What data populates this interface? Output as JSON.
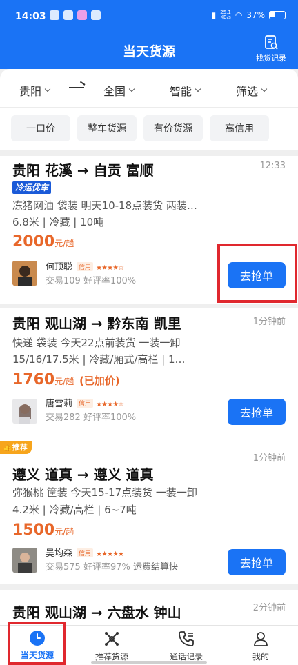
{
  "status_bar": {
    "time": "14:03",
    "speed_value": "25.1",
    "speed_unit": "KB/s",
    "battery": "37%"
  },
  "header": {
    "title": "当天货源",
    "find_record_label": "找货记录"
  },
  "filters": {
    "origin": "贵阳",
    "destination": "全国",
    "sort": "智能",
    "filter": "筛选"
  },
  "tags": [
    "一口价",
    "整车货源",
    "有价货源",
    "高信用"
  ],
  "cards": [
    {
      "route": "贵阳 花溪 → 自贡 富顺",
      "time": "12:33",
      "badge": "冷运优车",
      "desc1": "冻猪网油 袋装 明天10-18点装货 两装…",
      "desc2": "6.8米 | 冷藏 | 10吨",
      "price": "2000",
      "price_unit": "元/趟",
      "name": "何顶聪",
      "credit_label": "信用",
      "trade": "交易109 好评率100%",
      "button": "去抢单"
    },
    {
      "route": "贵阳 观山湖 → 黔东南 凯里",
      "time": "1分钟前",
      "desc1": "快递 袋装 今天22点前装货 一装一卸",
      "desc2": "15/16/17.5米 | 冷藏/厢式/高栏 | 1…",
      "price": "1760",
      "price_unit": "元/趟",
      "price_note": "(已加价)",
      "name": "唐雪莉",
      "credit_label": "信用",
      "trade": "交易282 好评率100%",
      "button": "去抢单"
    },
    {
      "recommend_badge": "推荐",
      "route": "遵义 道真 → 遵义 道真",
      "time": "1分钟前",
      "desc1": "弥猴桃 筐装 今天15-17点装货 一装一卸",
      "desc2": "4.2米 | 冷藏/高栏 | 6~7吨",
      "price": "1500",
      "price_unit": "元/趟",
      "name": "吴均森",
      "credit_label": "信用",
      "trade": "交易575 好评率97%",
      "trade_extra": "运费结算快",
      "button": "去抢单"
    },
    {
      "route": "贵阳 观山湖 → 六盘水 钟山",
      "time": "2分钟前"
    }
  ],
  "bottom_nav": [
    {
      "label": "当天货源",
      "active": true
    },
    {
      "label": "推荐货源"
    },
    {
      "label": "通话记录"
    },
    {
      "label": "我的"
    }
  ],
  "colors": {
    "brand_blue": "#1a73f5",
    "price_orange": "#e8672a",
    "highlight_red": "#e0282e"
  }
}
